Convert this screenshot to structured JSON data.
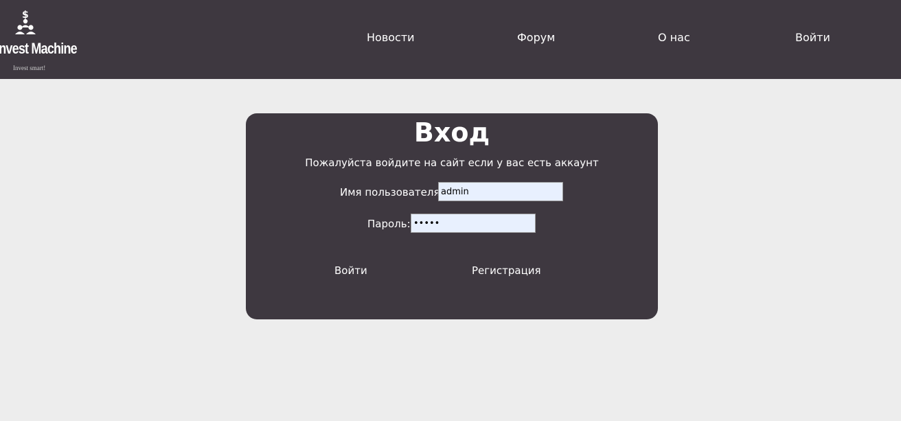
{
  "header": {
    "logo": {
      "icon": "people-dollar-icon",
      "title": "Invest Machine",
      "tagline": "Invest smart!"
    },
    "nav": {
      "news": "Новости",
      "forum": "Форум",
      "about": "О нас",
      "login": "Войти"
    }
  },
  "login_form": {
    "title": "Вход",
    "subtitle": "Пожалуйста войдите на сайт если у вас есть аккаунт",
    "username_label": "Имя пользователя:",
    "username_value": "admin",
    "password_label": "Пароль:",
    "password_value": "•••••",
    "submit_label": "Войти",
    "register_label": "Регистрация"
  },
  "colors": {
    "header_bg": "#3e3840",
    "page_bg": "#ededed",
    "card_bg": "#3e3840",
    "input_bg": "#e8f0fe"
  }
}
